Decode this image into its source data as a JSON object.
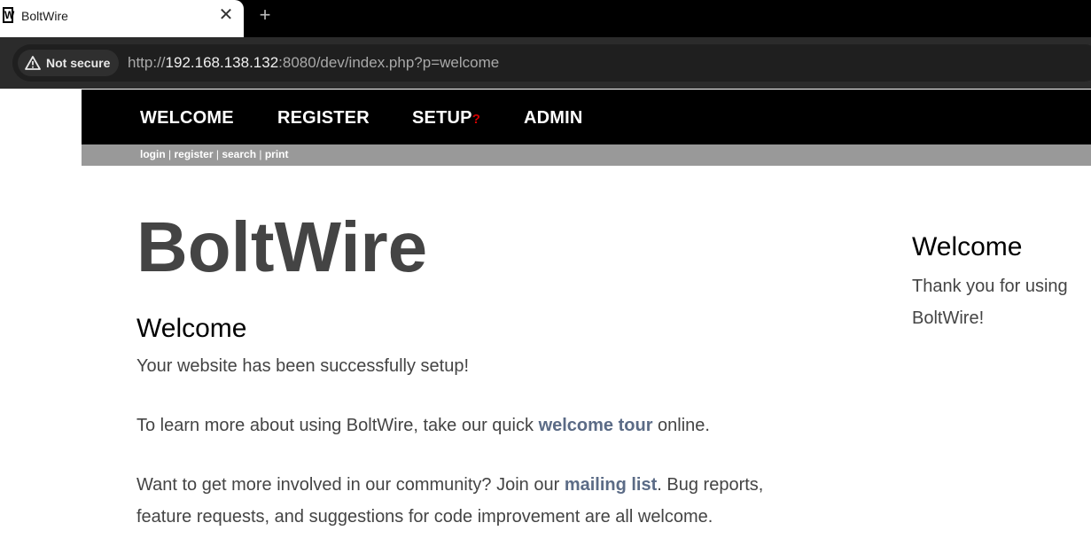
{
  "browser": {
    "tab_title": "BoltWire",
    "favicon_letter": "W",
    "close_glyph": "✕",
    "newtab_glyph": "+",
    "security_label": "Not secure",
    "url_scheme": "http://",
    "url_host": "192.168.138.132",
    "url_rest": ":8080/dev/index.php?p=welcome"
  },
  "nav": {
    "welcome": "WELCOME",
    "register": "REGISTER",
    "setup": "SETUP",
    "setup_mark": "?",
    "admin": "ADMIN"
  },
  "subnav": {
    "login": "login",
    "register": "register",
    "search": "search",
    "print": "print",
    "separator": "|"
  },
  "main": {
    "site_title": "BoltWire",
    "heading": "Welcome",
    "para1": "Your website has been successfully setup!",
    "para2_before": "To learn more about using BoltWire, take our quick ",
    "para2_link": "welcome tour",
    "para2_after": " online.",
    "para3_before": "Want to get more involved in our community? Join our ",
    "para3_link": "mailing list",
    "para3_after": ". Bug reports, feature requests, and suggestions for code improvement are all welcome."
  },
  "sidebar": {
    "heading": "Welcome",
    "text": "Thank you for using BoltWire!"
  },
  "colors": {
    "nav_bg": "#000000",
    "subnav_bg": "#999999",
    "link": "#5b6b86",
    "setup_mark": "#d40000"
  }
}
